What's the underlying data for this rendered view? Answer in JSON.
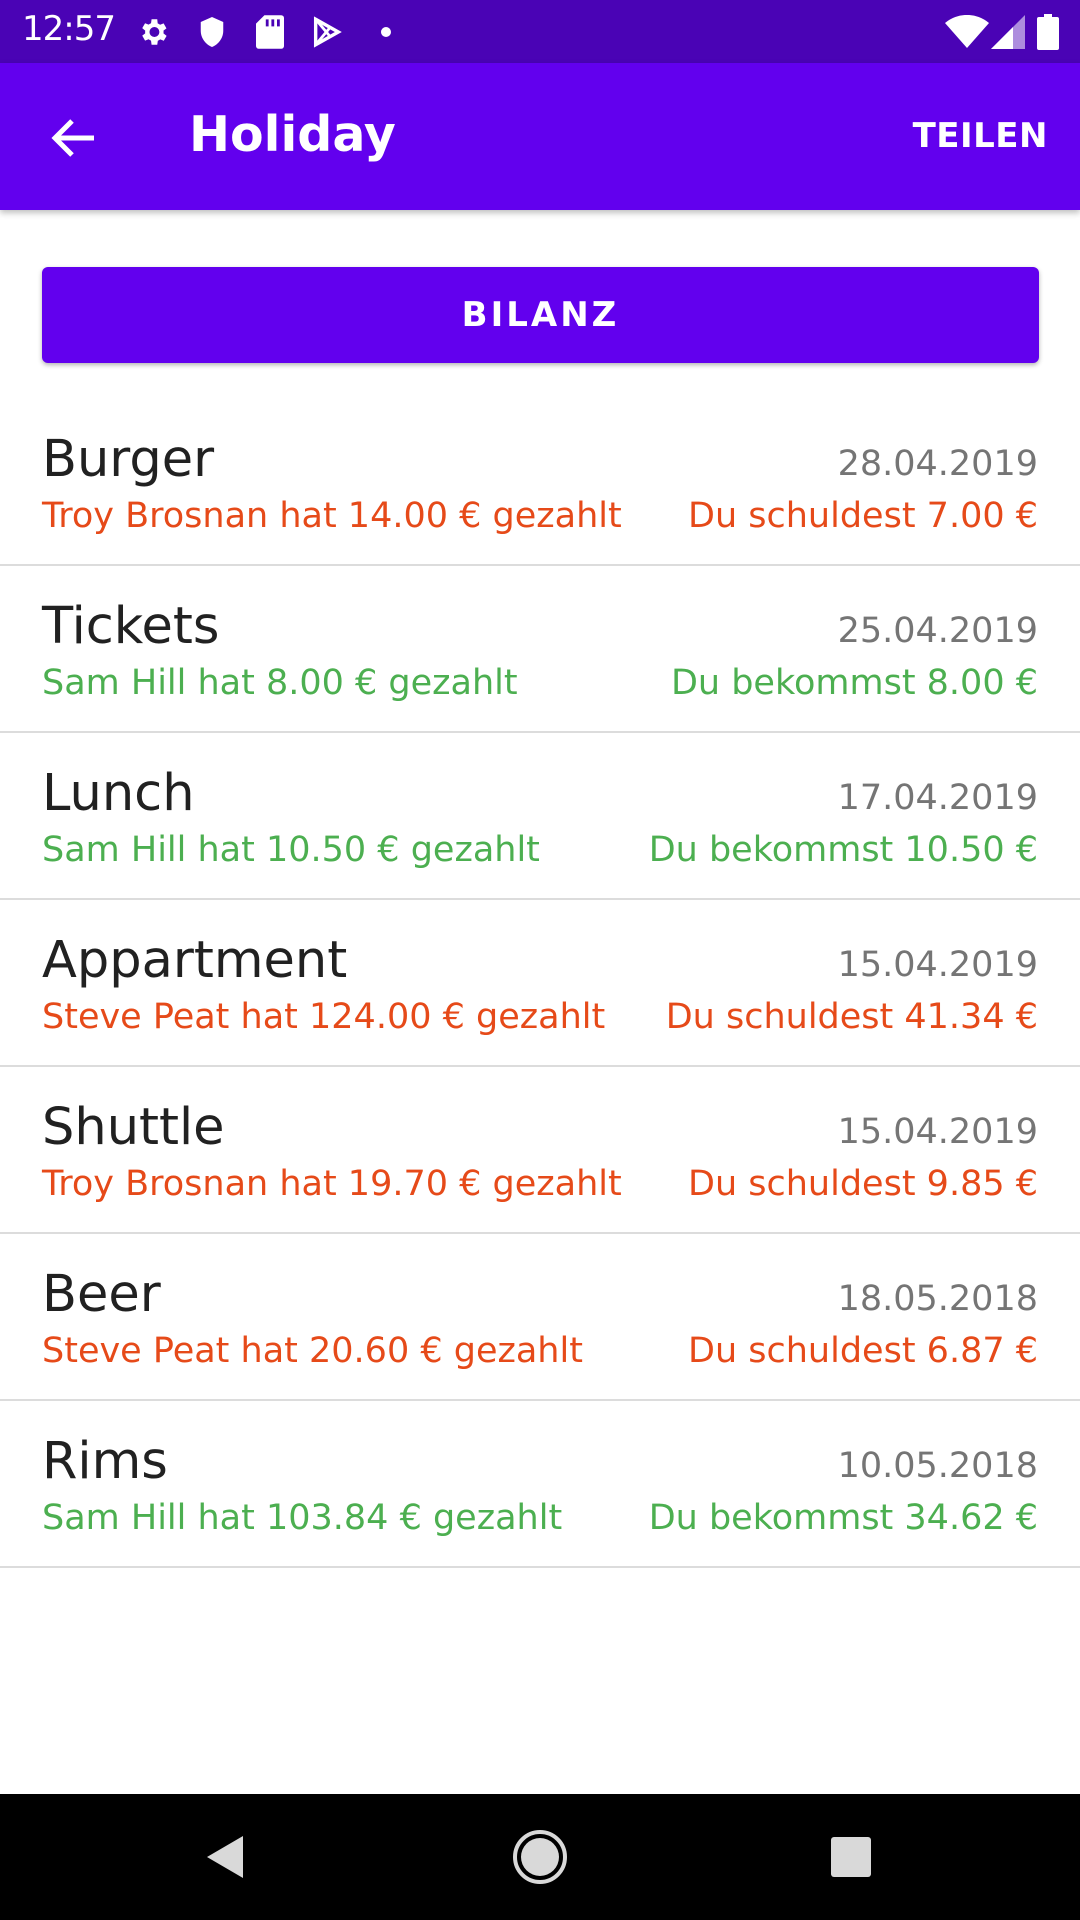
{
  "status_bar": {
    "time": "12:57",
    "icons": [
      "gear-icon",
      "shield-icon",
      "sd-card-icon",
      "play-store-icon",
      "dot-icon",
      "wifi-icon",
      "signal-icon",
      "battery-icon"
    ]
  },
  "app_bar": {
    "title": "Holiday",
    "share_label": "TEILEN"
  },
  "balance_button": {
    "label": "BILANZ"
  },
  "colors": {
    "primary": "#6200ee",
    "status_bar": "#4a03b5",
    "owe": "#e64a19",
    "receive": "#4caf50"
  },
  "expenses": [
    {
      "title": "Burger",
      "date": "28.04.2019",
      "paid": "Troy Brosnan hat 14.00 € gezahlt",
      "share": "Du schuldest 7.00 €",
      "status": "owe"
    },
    {
      "title": "Tickets",
      "date": "25.04.2019",
      "paid": "Sam Hill hat 8.00 € gezahlt",
      "share": "Du bekommst 8.00 €",
      "status": "receive"
    },
    {
      "title": "Lunch",
      "date": "17.04.2019",
      "paid": "Sam Hill hat 10.50 € gezahlt",
      "share": "Du bekommst 10.50 €",
      "status": "receive"
    },
    {
      "title": "Appartment",
      "date": "15.04.2019",
      "paid": "Steve Peat hat 124.00 € gezahlt",
      "share": "Du schuldest 41.34 €",
      "status": "owe"
    },
    {
      "title": "Shuttle",
      "date": "15.04.2019",
      "paid": "Troy Brosnan hat 19.70 € gezahlt",
      "share": "Du schuldest 9.85 €",
      "status": "owe"
    },
    {
      "title": "Beer",
      "date": "18.05.2018",
      "paid": "Steve Peat hat 20.60 € gezahlt",
      "share": "Du schuldest 6.87 €",
      "status": "owe"
    },
    {
      "title": "Rims",
      "date": "10.05.2018",
      "paid": "Sam Hill hat 103.84 € gezahlt",
      "share": "Du bekommst 34.62 €",
      "status": "receive"
    }
  ],
  "nav_bar": {
    "icons": [
      "back-triangle-icon",
      "home-circle-icon",
      "recents-square-icon"
    ]
  }
}
